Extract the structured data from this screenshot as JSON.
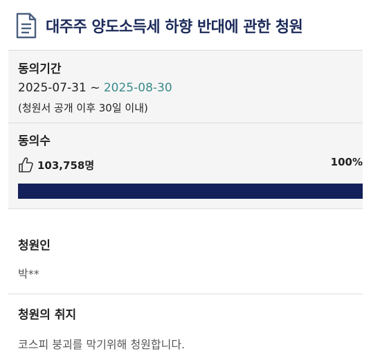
{
  "title": "대주주 양도소득세 하향 반대에 관한 청원",
  "consent_period": {
    "label": "동의기간",
    "start": "2025-07-31",
    "separator": " ~ ",
    "end": "2025-08-30",
    "note": "(청원서 공개 이후 30일 이내)"
  },
  "consent_count": {
    "label": "동의수",
    "value": "103,758명",
    "percent_text": "100%",
    "progress_fraction": 1.0,
    "fill_color": "#14205a"
  },
  "petitioner": {
    "label": "청원인",
    "value": "박**"
  },
  "purpose": {
    "label": "청원의 취지",
    "value": "코스피 붕괴를 막기위해 청원합니다."
  },
  "icons": {
    "title_icon": "document-icon",
    "count_icon": "thumbs-up-icon"
  }
}
